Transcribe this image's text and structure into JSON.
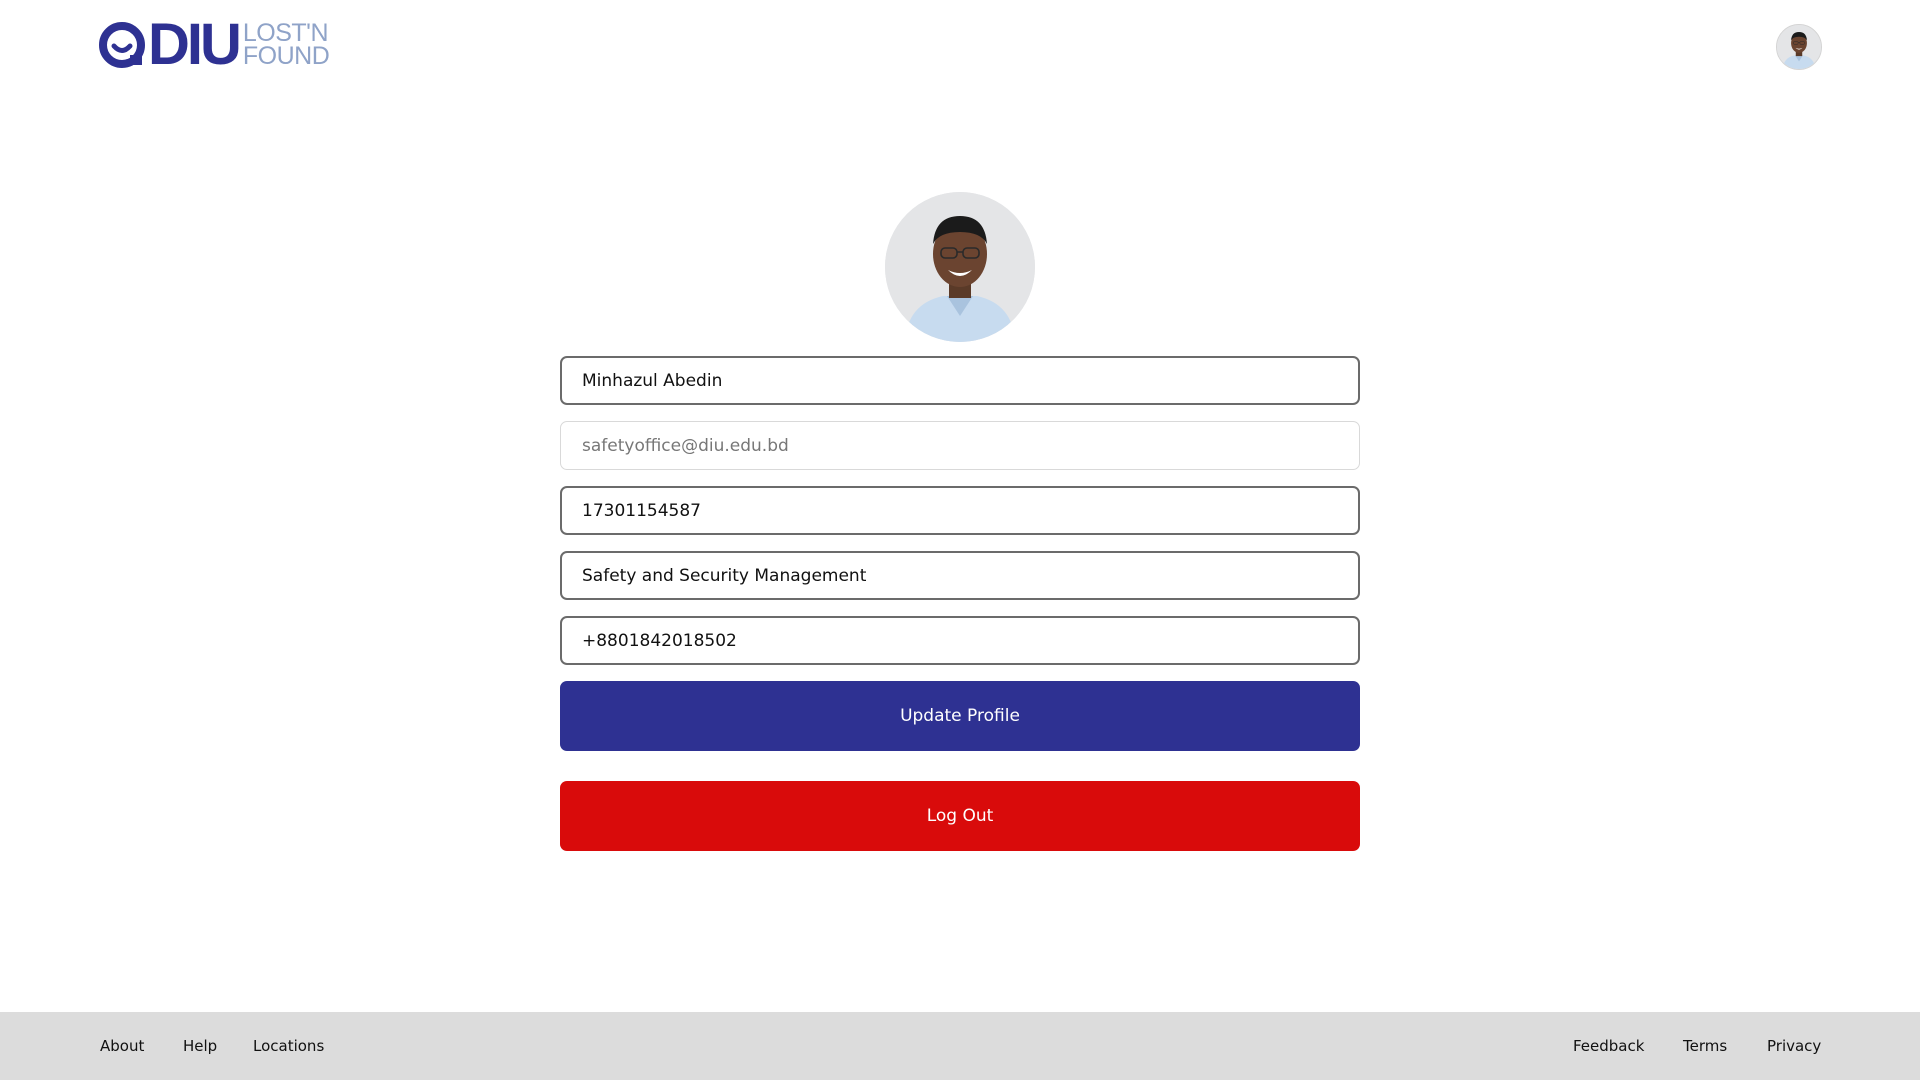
{
  "header": {
    "logo": {
      "brand": "DIU",
      "line1": "LOST'N",
      "line2": "FOUND",
      "icon": "diu-logo-icon",
      "color": "#2e3192",
      "sub_color": "#8fa3c8"
    },
    "avatar_icon": "user-avatar-icon"
  },
  "profile": {
    "photo_icon": "profile-photo",
    "name": "Minhazul Abedin",
    "email": "safetyoffice@diu.edu.bd",
    "id": "17301154587",
    "department": "Safety and Security Management",
    "phone": "+8801842018502"
  },
  "actions": {
    "update_label": "Update Profile",
    "update_color": "#2e3192",
    "logout_label": "Log Out",
    "logout_color": "#d90b0b"
  },
  "footer": {
    "left_links": [
      "About",
      "Help",
      "Locations"
    ],
    "right_links": [
      "Feedback",
      "Terms",
      "Privacy"
    ]
  }
}
